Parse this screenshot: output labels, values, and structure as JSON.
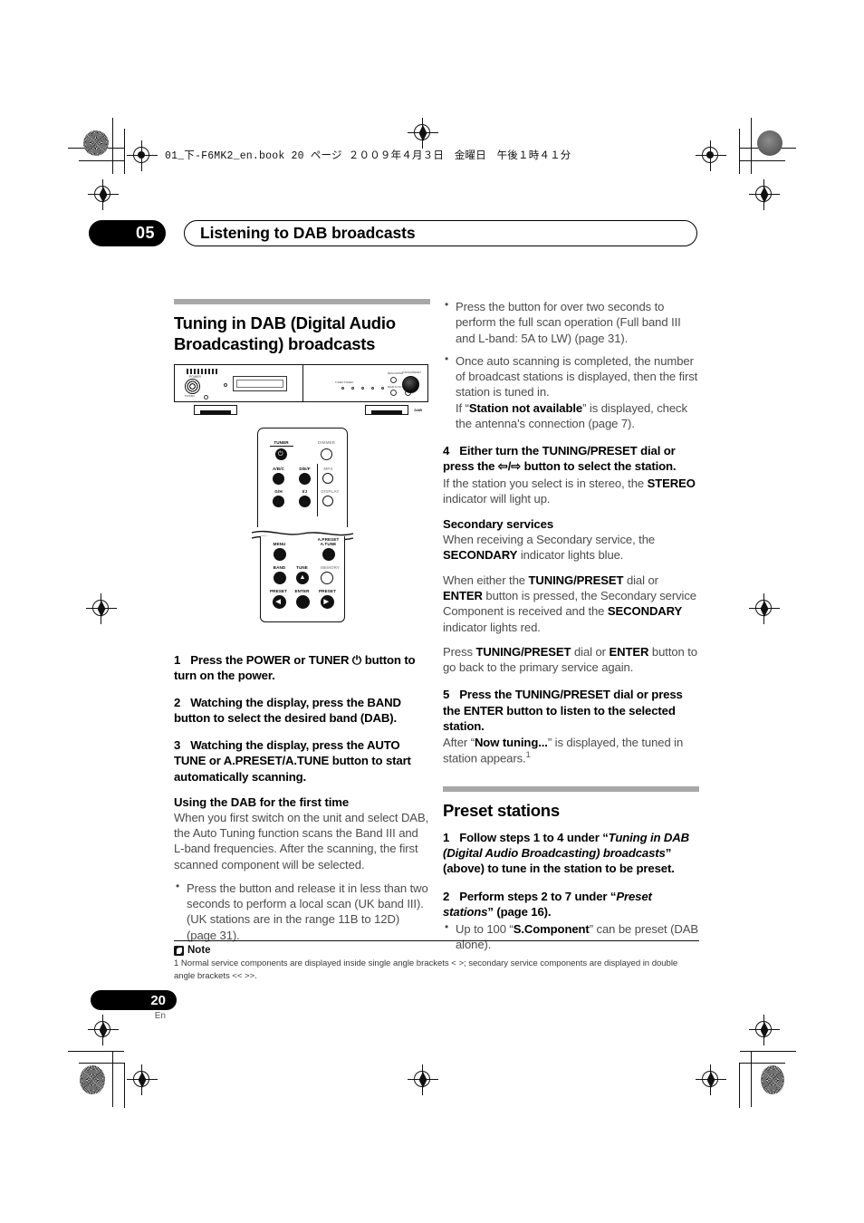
{
  "print_marks": {
    "filename_line": "01_下-F6MK2_en.book  20 ページ  ２００９年４月３日　金曜日　午後１時４１分"
  },
  "chapter": {
    "number": "05",
    "title": "Listening to DAB broadcasts"
  },
  "left_column": {
    "section_title": "Tuning in DAB (Digital Audio Broadcasting) broadcasts",
    "device_illustration": {
      "brand": "PIONEER",
      "power_label": "POWER",
      "standby_label": "STANDBY",
      "band_label": "DAB",
      "indicator_labels": [
        "TUNED",
        "STEREO",
        "SECONDARY",
        "MEMORY",
        "RDS"
      ],
      "control_labels": [
        "MENU",
        "ENTER",
        "BAND",
        "AUTO TUNE",
        "TUNING/PRESET"
      ]
    },
    "remote_illustration": {
      "buttons": [
        {
          "label": "TUNER",
          "sub": "⏻",
          "style": "filled-power"
        },
        {
          "label": "DIMMER",
          "style": "hollow"
        },
        {
          "label": "A/B/C",
          "style": "filled"
        },
        {
          "label": "D/E/F",
          "style": "filled"
        },
        {
          "label": "MPX",
          "style": "hollow"
        },
        {
          "label": "G/H",
          "style": "filled"
        },
        {
          "label": "I/J",
          "style": "filled"
        },
        {
          "label": "DISPLAY",
          "style": "hollow"
        },
        {
          "label": "MENU",
          "style": "filled"
        },
        {
          "label": "A.PRESET\nA.TUNE",
          "style": "filled"
        },
        {
          "label": "BAND",
          "style": "filled"
        },
        {
          "label": "TUNE",
          "sub": "+",
          "style": "filled"
        },
        {
          "label": "MEMORY",
          "style": "hollow"
        },
        {
          "label": "PRESET",
          "sub": "◀",
          "style": "filled"
        },
        {
          "label": "ENTER",
          "style": "filled"
        },
        {
          "label": "PRESET",
          "sub": "▶",
          "style": "filled"
        },
        {
          "label": "TUNE",
          "sub": "▼",
          "style": "filled"
        }
      ]
    },
    "step1": {
      "num": "1",
      "text": "Press the POWER or TUNER ⏻ button to turn on the power."
    },
    "step2": {
      "num": "2",
      "text": "Watching the display, press the BAND button to select the desired band (DAB)."
    },
    "step3": {
      "num": "3",
      "text": "Watching the display, press the AUTO TUNE or A.PRESET/A.TUNE button to start automatically scanning."
    },
    "first_time": {
      "heading": "Using the DAB for the first time",
      "body": "When you first switch on the unit and select DAB, the Auto Tuning function scans the Band III and L-band frequencies. After the scanning, the first scanned component will be selected.",
      "bullet": "Press the button and release it in less than two seconds to perform a local scan (UK band III). (UK stations are in the range 11B to 12D) (page 31)."
    }
  },
  "right_column": {
    "bullet1": "Press the button for over two seconds to perform the full scan operation (Full band III and L-band: 5A to LW) (page 31).",
    "bullet2_part1": "Once auto scanning is completed, the number of broadcast stations is displayed, then the first station is tuned in.",
    "bullet2_prefix": "If “",
    "bullet2_bold": "Station not available",
    "bullet2_suffix": "” is displayed, check the antenna's connection (page 7).",
    "step4": {
      "num": "4",
      "text": "Either turn the TUNING/PRESET dial or press the ⇦/⇨ button to select the station.",
      "body_pre": "If the station you select is in stereo, the ",
      "body_bold": "STEREO",
      "body_post": " indicator will light up."
    },
    "secondary": {
      "heading": "Secondary services",
      "p1_pre": "When receiving a Secondary service, the ",
      "p1_bold": "SECONDARY",
      "p1_post": " indicator lights blue.",
      "p2_a": "When either the ",
      "p2_b1": "TUNING/PRESET",
      "p2_c": " dial or ",
      "p2_b2": "ENTER",
      "p2_d": " button is pressed, the Secondary service Component is received and the ",
      "p2_b3": "SECONDARY",
      "p2_e": " indicator lights red.",
      "p3_a": "Press ",
      "p3_b1": "TUNING/PRESET",
      "p3_c": " dial or ",
      "p3_b2": "ENTER",
      "p3_d": " button to go back to the primary service again."
    },
    "step5": {
      "num": "5",
      "text": "Press the TUNING/PRESET dial or press the ENTER button to listen to the selected station.",
      "body_pre": "After “",
      "body_bold": "Now tuning...",
      "body_post": "” is displayed, the tuned in station appears.",
      "footnote_marker": "1"
    },
    "preset_section": {
      "title": "Preset stations",
      "step1": {
        "num": "1",
        "a": "Follow steps 1 to 4 under “",
        "italic": "Tuning in DAB (Digital Audio Broadcasting) broadcasts",
        "b": "” (above) to tune in the station to be preset."
      },
      "step2": {
        "num": "2",
        "a": "Perform steps 2 to 7 under “",
        "italic": "Preset stations",
        "b": "” (page 16)."
      },
      "bullet_pre": "Up to 100 “",
      "bullet_bold": "S.Component",
      "bullet_post": "” can be preset (DAB alone)."
    }
  },
  "note": {
    "title": "Note",
    "text": "1 Normal service components are displayed inside single angle brackets <  >; secondary service components are displayed in double angle brackets  <<  >>."
  },
  "footer": {
    "page_number": "20",
    "language": "En"
  }
}
